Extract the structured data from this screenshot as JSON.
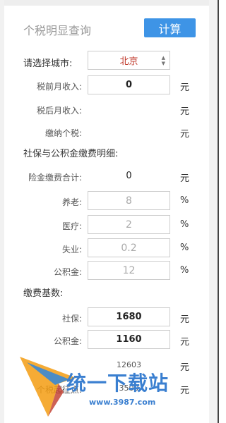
{
  "header": {
    "title": "个税明显查询",
    "calc_button": "计算"
  },
  "city": {
    "label": "请选择城市:",
    "value": "北京"
  },
  "income": {
    "pre_tax_label": "税前月收入:",
    "pre_tax_value": "0",
    "pre_tax_unit": "元",
    "post_tax_label": "税后月收入:",
    "post_tax_unit": "元",
    "tax_label": "缴纳个税:",
    "tax_unit": "元"
  },
  "social": {
    "section_label": "社保与公积金缴费明细:",
    "total_label": "险金缴费合计:",
    "total_value": "0",
    "total_unit": "元",
    "pension_label": "养老:",
    "pension_value": "8",
    "pension_unit": "%",
    "medical_label": "医疗:",
    "medical_value": "2",
    "medical_unit": "%",
    "unemployment_label": "失业:",
    "unemployment_value": "0.2",
    "unemployment_unit": "%",
    "fund_label": "公积金:",
    "fund_value": "12",
    "fund_unit": "%"
  },
  "base": {
    "section_label": "缴费基数:",
    "social_label": "社保:",
    "social_value": "1680",
    "social_unit": "元",
    "fund_label": "公积金:",
    "fund_value": "1160",
    "fund_unit": "元",
    "row3_value": "12603",
    "row3_unit": "元",
    "threshold_label": "个税起征点:",
    "threshold_value": "3500",
    "threshold_unit": "元"
  },
  "watermark": {
    "text": "统一下载站",
    "url": "www.3987.com"
  },
  "colors": {
    "button": "#3e94e6",
    "city": "#c0392b",
    "watermark": "#3a7fd0"
  }
}
